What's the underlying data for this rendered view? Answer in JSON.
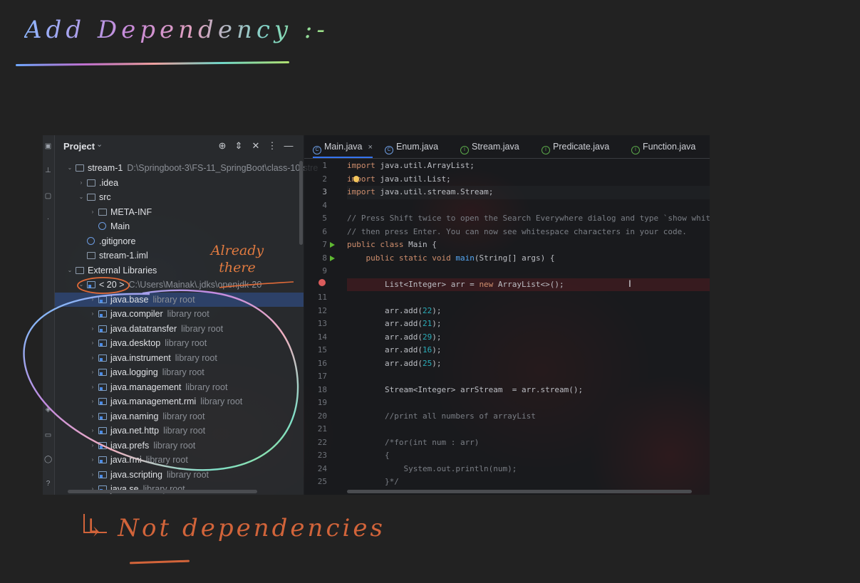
{
  "notes": {
    "title": "Add Dependency :-",
    "already_there": "Already there",
    "not_dependencies": "↳ Not dependencies"
  },
  "project_panel": {
    "title": "Project",
    "header_icons": [
      "locate-icon",
      "expand-icon",
      "collapse-icon",
      "more-icon",
      "minimize-icon"
    ],
    "tree": [
      {
        "label": "stream-1",
        "hint": "D:\\Springboot-3\\FS-11_SpringBoot\\class-10-stre",
        "level": 1,
        "icon": "module-folder",
        "arrow": "down"
      },
      {
        "label": ".idea",
        "hint": "",
        "level": 2,
        "icon": "folder",
        "arrow": "right"
      },
      {
        "label": "src",
        "hint": "",
        "level": 2,
        "icon": "source-folder",
        "arrow": "down"
      },
      {
        "label": "META-INF",
        "hint": "",
        "level": 3,
        "icon": "folder",
        "arrow": "right"
      },
      {
        "label": "Main",
        "hint": "",
        "level": 3,
        "icon": "class",
        "arrow": ""
      },
      {
        "label": ".gitignore",
        "hint": "",
        "level": 2,
        "icon": "ignore-file",
        "arrow": ""
      },
      {
        "label": "stream-1.iml",
        "hint": "",
        "level": 2,
        "icon": "iml-file",
        "arrow": ""
      },
      {
        "label": "External Libraries",
        "hint": "",
        "level": 1,
        "icon": "libraries",
        "arrow": "down"
      },
      {
        "label": "< 20 >",
        "hint": "C:\\Users\\Mainak\\.jdks\\openjdk-20",
        "level": 2,
        "icon": "jdk",
        "arrow": "down"
      },
      {
        "label": "java.base",
        "hint": "library root",
        "level": 3,
        "icon": "library",
        "arrow": "right",
        "selected": true
      },
      {
        "label": "java.compiler",
        "hint": "library root",
        "level": 3,
        "icon": "library",
        "arrow": "right"
      },
      {
        "label": "java.datatransfer",
        "hint": "library root",
        "level": 3,
        "icon": "library",
        "arrow": "right"
      },
      {
        "label": "java.desktop",
        "hint": "library root",
        "level": 3,
        "icon": "library",
        "arrow": "right"
      },
      {
        "label": "java.instrument",
        "hint": "library root",
        "level": 3,
        "icon": "library",
        "arrow": "right"
      },
      {
        "label": "java.logging",
        "hint": "library root",
        "level": 3,
        "icon": "library",
        "arrow": "right"
      },
      {
        "label": "java.management",
        "hint": "library root",
        "level": 3,
        "icon": "library",
        "arrow": "right"
      },
      {
        "label": "java.management.rmi",
        "hint": "library root",
        "level": 3,
        "icon": "library",
        "arrow": "right"
      },
      {
        "label": "java.naming",
        "hint": "library root",
        "level": 3,
        "icon": "library",
        "arrow": "right"
      },
      {
        "label": "java.net.http",
        "hint": "library root",
        "level": 3,
        "icon": "library",
        "arrow": "right"
      },
      {
        "label": "java.prefs",
        "hint": "library root",
        "level": 3,
        "icon": "library",
        "arrow": "right"
      },
      {
        "label": "java.rmi",
        "hint": "library root",
        "level": 3,
        "icon": "library",
        "arrow": "right"
      },
      {
        "label": "java.scripting",
        "hint": "library root",
        "level": 3,
        "icon": "library",
        "arrow": "right"
      },
      {
        "label": "java.se",
        "hint": "library root",
        "level": 3,
        "icon": "library",
        "arrow": "right"
      }
    ]
  },
  "editor": {
    "tabs": [
      {
        "label": "Main.java",
        "icon": "class",
        "active": true,
        "closable": true
      },
      {
        "label": "Enum.java",
        "icon": "class",
        "active": false,
        "closable": false
      },
      {
        "label": "Stream.java",
        "icon": "interface",
        "active": false,
        "closable": false
      },
      {
        "label": "Predicate.java",
        "icon": "interface",
        "active": false,
        "closable": false
      },
      {
        "label": "Function.java",
        "icon": "interface",
        "active": false,
        "closable": false
      }
    ],
    "close_glyph": "×",
    "lines": [
      {
        "no": "1",
        "text": "import java.util.ArrayList;"
      },
      {
        "no": "2",
        "text": "import java.util.List;"
      },
      {
        "no": "3",
        "text": "import java.util.stream.Stream;",
        "caret": true
      },
      {
        "no": "4",
        "text": ""
      },
      {
        "no": "5",
        "text": "// Press Shift twice to open the Search Everywhere dialog and type `show white"
      },
      {
        "no": "6",
        "text": "// then press Enter. You can now see whitespace characters in your code."
      },
      {
        "no": "7",
        "text": "public class Main {",
        "run": true
      },
      {
        "no": "8",
        "text": "    public static void main(String[] args) {",
        "run": true
      },
      {
        "no": "9",
        "text": ""
      },
      {
        "no": "",
        "text": "        List<Integer> arr = new ArrayList<>();",
        "breakpoint": true
      },
      {
        "no": "11",
        "text": ""
      },
      {
        "no": "12",
        "text": "        arr.add(22);"
      },
      {
        "no": "13",
        "text": "        arr.add(21);"
      },
      {
        "no": "14",
        "text": "        arr.add(29);"
      },
      {
        "no": "15",
        "text": "        arr.add(16);"
      },
      {
        "no": "16",
        "text": "        arr.add(25);"
      },
      {
        "no": "17",
        "text": ""
      },
      {
        "no": "18",
        "text": "        Stream<Integer> arrStream  = arr.stream();"
      },
      {
        "no": "19",
        "text": ""
      },
      {
        "no": "20",
        "text": "        //print all numbers of arrayList"
      },
      {
        "no": "21",
        "text": ""
      },
      {
        "no": "22",
        "text": "        /*for(int num : arr)"
      },
      {
        "no": "23",
        "text": "        {"
      },
      {
        "no": "24",
        "text": "            System.out.println(num);"
      },
      {
        "no": "25",
        "text": "        }*/"
      }
    ]
  },
  "colors": {
    "accent": "#3574f0",
    "keyword": "#cf8e6d",
    "number": "#2aacb8",
    "comment": "#7a7e85",
    "method": "#56a8f5",
    "annotation_orange": "#d2643a"
  }
}
